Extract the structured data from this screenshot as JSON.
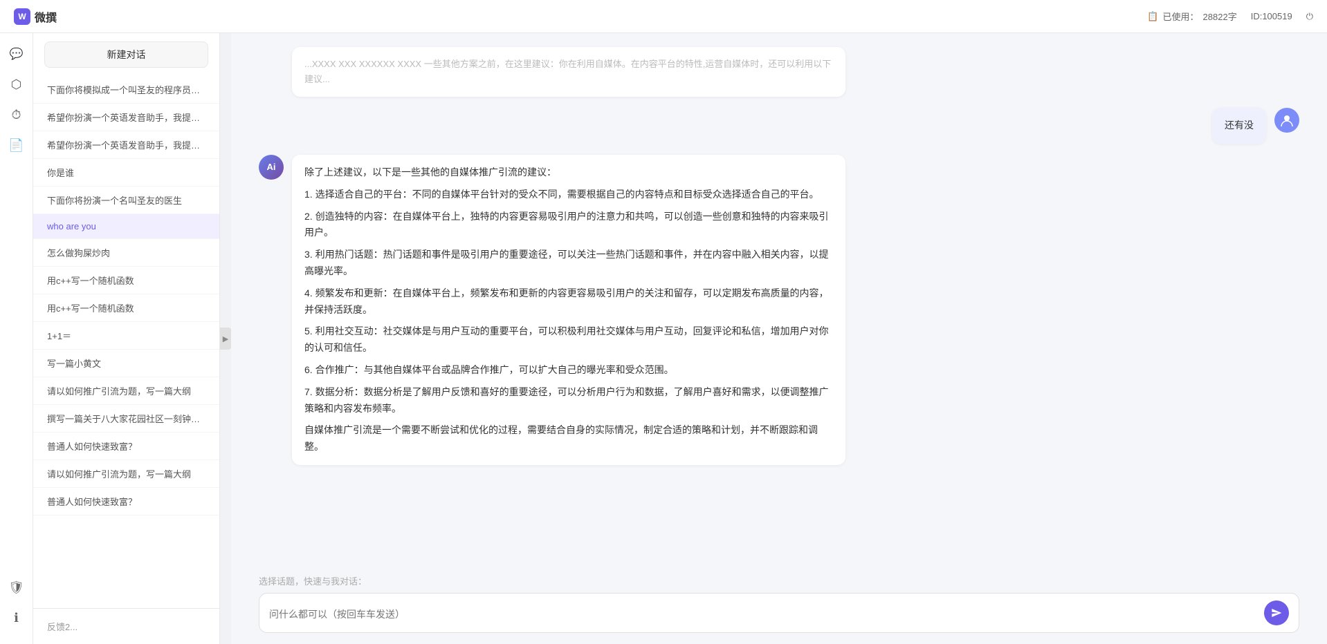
{
  "topbar": {
    "logo": "微撰",
    "usage_label": "已使用：",
    "usage_value": "28822字",
    "id_label": "ID:100519"
  },
  "sidebar": {
    "new_btn": "新建对话",
    "items": [
      {
        "id": 1,
        "text": "下面你将模拟成一个叫圣友的程序员，我说...",
        "active": false
      },
      {
        "id": 2,
        "text": "希望你扮演一个英语发音助手，我提供给你...",
        "active": false
      },
      {
        "id": 3,
        "text": "希望你扮演一个英语发音助手，我提供给你...",
        "active": false
      },
      {
        "id": 4,
        "text": "你是谁",
        "active": false
      },
      {
        "id": 5,
        "text": "下面你将扮演一个名叫圣友的医生",
        "active": false
      },
      {
        "id": 6,
        "text": "who are you",
        "active": true
      },
      {
        "id": 7,
        "text": "怎么做狗屎炒肉",
        "active": false
      },
      {
        "id": 8,
        "text": "用c++写一个随机函数",
        "active": false
      },
      {
        "id": 9,
        "text": "用c++写一个随机函数",
        "active": false
      },
      {
        "id": 10,
        "text": "1+1＝",
        "active": false
      },
      {
        "id": 11,
        "text": "写一篇小黄文",
        "active": false
      },
      {
        "id": 12,
        "text": "请以如何推广引流为题，写一篇大纲",
        "active": false
      },
      {
        "id": 13,
        "text": "撰写一篇关于八大家花园社区一刻钟便民生...",
        "active": false
      },
      {
        "id": 14,
        "text": "普通人如何快速致富？",
        "active": false
      },
      {
        "id": 15,
        "text": "请以如何推广引流为题，写一篇大纲",
        "active": false
      },
      {
        "id": 16,
        "text": "普通人如何快速致富？",
        "active": false
      }
    ],
    "bottom_items": [
      "反馈2..."
    ]
  },
  "chat": {
    "partial_msg": "...",
    "user_msg_1": "还有没",
    "ai_msg_1": {
      "lines": [
        "除了上述建议，以下是一些其他的自媒体推广引流的建议：",
        "1. 选择适合自己的平台：不同的自媒体平台针对的受众不同，需要根据自己的内容特点和目标受众选择适合自己的平台。",
        "2. 创造独特的内容：在自媒体平台上，独特的内容更容易吸引用户的注意力和共鸣，可以创造一些创意和独特的内容来吸引用户。",
        "3. 利用热门话题：热门话题和事件是吸引用户的重要途径，可以关注一些热门话题和事件，并在内容中融入相关内容，以提高曝光率。",
        "4. 频繁发布和更新：在自媒体平台上，频繁发布和更新的内容更容易吸引用户的关注和留存，可以定期发布高质量的内容，并保持活跃度。",
        "5. 利用社交互动：社交媒体是与用户互动的重要平台，可以积极利用社交媒体与用户互动，回复评论和私信，增加用户对你的认可和信任。",
        "6. 合作推广：与其他自媒体平台或品牌合作推广，可以扩大自己的曝光率和受众范围。",
        "7. 数据分析：数据分析是了解用户反馈和喜好的重要途径，可以分析用户行为和数据，了解用户喜好和需求，以便调整推广策略和内容发布频率。",
        "自媒体推广引流是一个需要不断尝试和优化的过程，需要结合自身的实际情况，制定合适的策略和计划，并不断跟踪和调整。"
      ]
    },
    "quick_topics_label": "选择话题，快速与我对话：",
    "input_placeholder": "问什么都可以（按回车车发送）"
  },
  "icons": {
    "collapse_arrow": "▶",
    "send_icon": "➤",
    "logo_w": "W",
    "cube_icon": "⬡",
    "clock_icon": "⏰",
    "doc_icon": "📄",
    "shield_icon": "🛡",
    "info_icon": "ℹ"
  }
}
